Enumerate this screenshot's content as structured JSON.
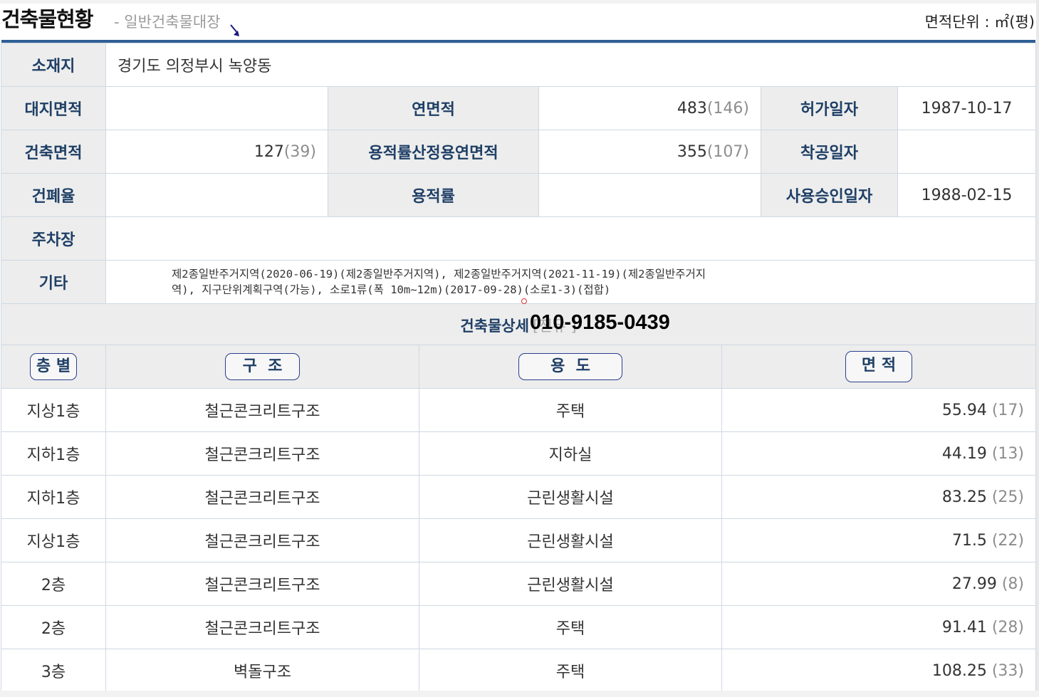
{
  "header": {
    "title": "건축물현황",
    "subtitle": "- 일반건축물대장",
    "unit_label": "면적단위 : ㎡(평)"
  },
  "info": {
    "location_label": "소재지",
    "location_value": "경기도 의정부시 녹양동",
    "site_area_label": "대지면적",
    "site_area_value": "",
    "total_floor_area_label": "연면적",
    "total_floor_area_value": "483",
    "total_floor_area_pyeong": "(146)",
    "permit_date_label": "허가일자",
    "permit_date_value": "1987-10-17",
    "building_area_label": "건축면적",
    "building_area_value": "127",
    "building_area_pyeong": "(39)",
    "far_floor_area_label": "용적률산정용연면적",
    "far_floor_area_value": "355",
    "far_floor_area_pyeong": "(107)",
    "start_date_label": "착공일자",
    "start_date_value": "",
    "coverage_label": "건폐율",
    "coverage_value": "",
    "far_label": "용적률",
    "far_value": "",
    "approval_date_label": "사용승인일자",
    "approval_date_value": "1988-02-15",
    "parking_label": "주차장",
    "parking_value": "",
    "etc_label": "기타",
    "etc_value": "제2종일반주거지역(2020-06-19)(제2종일반주거지역), 제2종일반주거지역(2021-11-19)(제2종일반주거지역), 지구단위계획구역(가능), 소로1류(폭 10m~12m)(2017-09-28)(소로1-3)(접합)"
  },
  "detail": {
    "title": "건축물상세",
    "box_text": "[전유 ]",
    "phone_overlay": "010-9185-0439"
  },
  "floors": {
    "headers": {
      "floor": "층 별",
      "structure": "구  조",
      "usage": "용  도",
      "area": "면 적"
    },
    "rows": [
      {
        "floor": "지상1층",
        "structure": "철근콘크리트구조",
        "usage": "주택",
        "area": "55.94",
        "pyeong": "(17)"
      },
      {
        "floor": "지하1층",
        "structure": "철근콘크리트구조",
        "usage": "지하실",
        "area": "44.19",
        "pyeong": "(13)"
      },
      {
        "floor": "지하1층",
        "structure": "철근콘크리트구조",
        "usage": "근린생활시설",
        "area": "83.25",
        "pyeong": "(25)"
      },
      {
        "floor": "지상1층",
        "structure": "철근콘크리트구조",
        "usage": "근린생활시설",
        "area": "71.5",
        "pyeong": "(22)"
      },
      {
        "floor": "2층",
        "structure": "철근콘크리트구조",
        "usage": "근린생활시설",
        "area": "27.99",
        "pyeong": "(8)"
      },
      {
        "floor": "2층",
        "structure": "철근콘크리트구조",
        "usage": "주택",
        "area": "91.41",
        "pyeong": "(28)"
      },
      {
        "floor": "3층",
        "structure": "벽돌구조",
        "usage": "주택",
        "area": "108.25",
        "pyeong": "(33)"
      }
    ]
  },
  "colors": {
    "label_text": "#1f3f66",
    "label_bg": "#ededed",
    "rule_blue": "#2f5f95",
    "pill_border": "#2a3f8f"
  }
}
